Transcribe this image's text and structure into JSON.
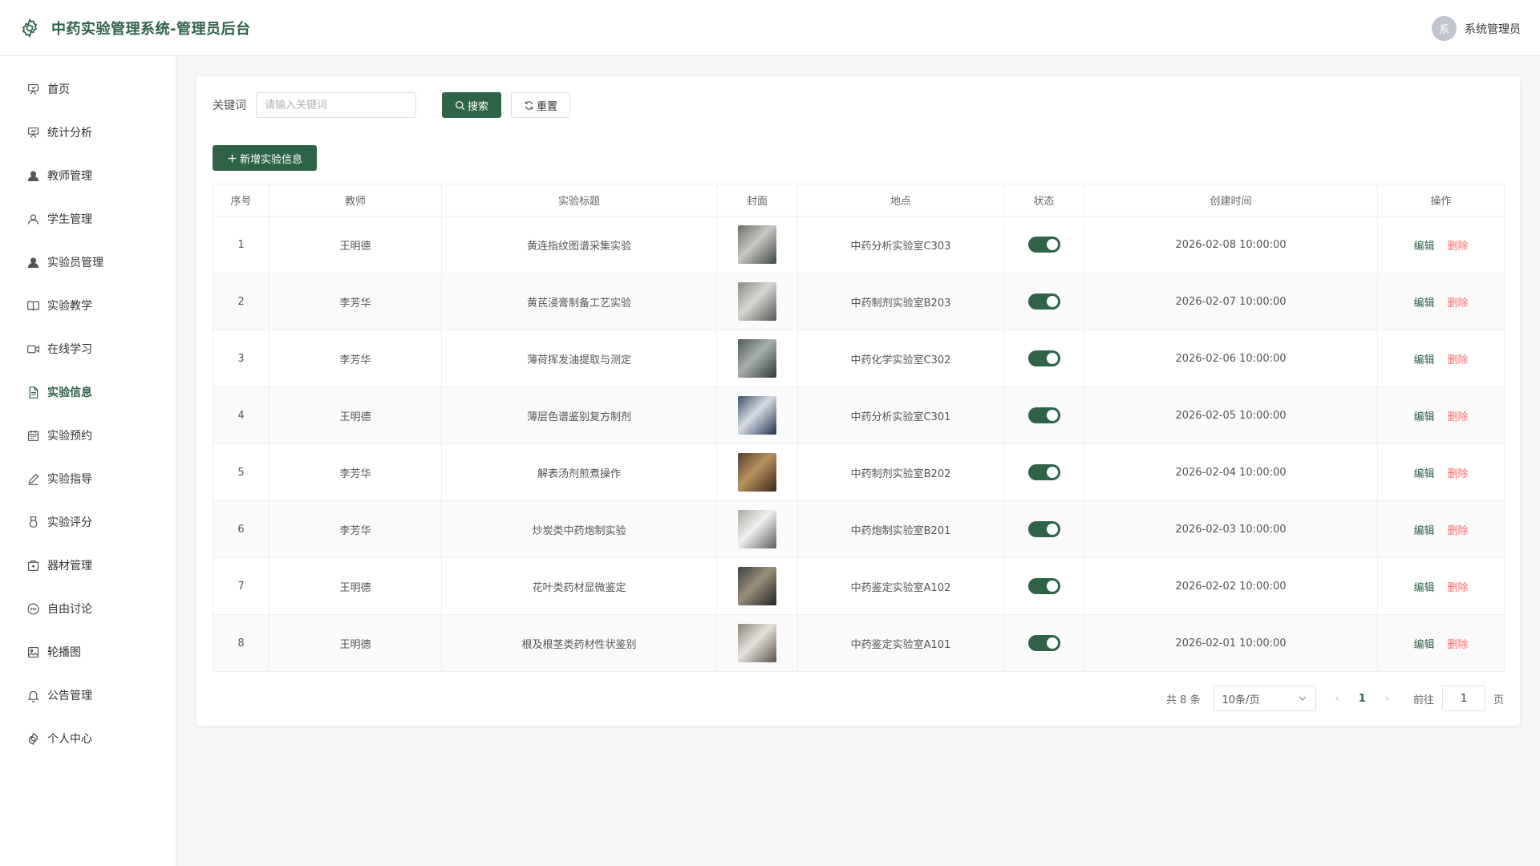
{
  "header": {
    "title": "中药实验管理系统-管理员后台",
    "avatar_text": "系",
    "user_name": "系统管理员"
  },
  "sidebar": {
    "items": [
      {
        "label": "首页",
        "icon": "easel-icon"
      },
      {
        "label": "统计分析",
        "icon": "presentation-icon"
      },
      {
        "label": "教师管理",
        "icon": "user-solid-icon"
      },
      {
        "label": "学生管理",
        "icon": "user-outline-icon"
      },
      {
        "label": "实验员管理",
        "icon": "user-solid-icon"
      },
      {
        "label": "实验教学",
        "icon": "book-icon"
      },
      {
        "label": "在线学习",
        "icon": "video-camera-icon"
      },
      {
        "label": "实验信息",
        "icon": "document-icon"
      },
      {
        "label": "实验预约",
        "icon": "calendar-icon"
      },
      {
        "label": "实验指导",
        "icon": "pen-icon"
      },
      {
        "label": "实验评分",
        "icon": "medal-icon"
      },
      {
        "label": "器材管理",
        "icon": "box-icon"
      },
      {
        "label": "自由讨论",
        "icon": "chat-icon"
      },
      {
        "label": "轮播图",
        "icon": "picture-icon"
      },
      {
        "label": "公告管理",
        "icon": "bell-icon"
      },
      {
        "label": "个人中心",
        "icon": "gear-icon"
      }
    ],
    "active_index": 7
  },
  "search": {
    "label": "关键词",
    "placeholder": "请输入关键词",
    "value": "",
    "search_label": "搜索",
    "reset_label": "重置"
  },
  "toolbar": {
    "add_label": "新增实验信息"
  },
  "table": {
    "columns": [
      "序号",
      "教师",
      "实验标题",
      "封面",
      "地点",
      "状态",
      "创建时间",
      "操作"
    ],
    "edit_label": "编辑",
    "delete_label": "删除",
    "rows": [
      {
        "index": "1",
        "teacher": "王明德",
        "title": "黄连指纹图谱采集实验",
        "location": "中药分析实验室C303",
        "status": true,
        "created": "2026-02-08 10:00:00"
      },
      {
        "index": "2",
        "teacher": "李芳华",
        "title": "黄芪浸膏制备工艺实验",
        "location": "中药制剂实验室B203",
        "status": true,
        "created": "2026-02-07 10:00:00"
      },
      {
        "index": "3",
        "teacher": "李芳华",
        "title": "薄荷挥发油提取与测定",
        "location": "中药化学实验室C302",
        "status": true,
        "created": "2026-02-06 10:00:00"
      },
      {
        "index": "4",
        "teacher": "王明德",
        "title": "薄层色谱鉴别复方制剂",
        "location": "中药分析实验室C301",
        "status": true,
        "created": "2026-02-05 10:00:00"
      },
      {
        "index": "5",
        "teacher": "李芳华",
        "title": "解表汤剂煎煮操作",
        "location": "中药制剂实验室B202",
        "status": true,
        "created": "2026-02-04 10:00:00"
      },
      {
        "index": "6",
        "teacher": "李芳华",
        "title": "炒炭类中药炮制实验",
        "location": "中药炮制实验室B201",
        "status": true,
        "created": "2026-02-03 10:00:00"
      },
      {
        "index": "7",
        "teacher": "王明德",
        "title": "花叶类药材显微鉴定",
        "location": "中药鉴定实验室A102",
        "status": true,
        "created": "2026-02-02 10:00:00"
      },
      {
        "index": "8",
        "teacher": "王明德",
        "title": "根及根茎类药材性状鉴别",
        "location": "中药鉴定实验室A101",
        "status": true,
        "created": "2026-02-01 10:00:00"
      }
    ]
  },
  "pagination": {
    "total_text": "共 8 条",
    "page_size": "10条/页",
    "current_page": "1",
    "goto_label": "前往",
    "goto_value": "1",
    "page_unit": "页"
  },
  "colors": {
    "primary": "#2e6347",
    "danger": "#f56c6c"
  }
}
